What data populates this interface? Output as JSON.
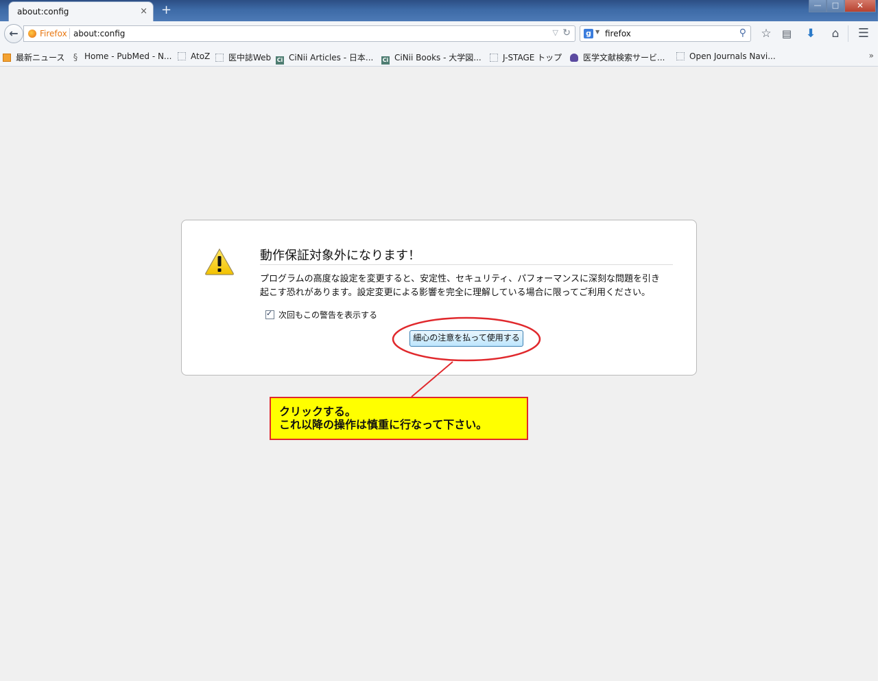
{
  "window": {
    "tab_title": "about:config",
    "tab_close": "×",
    "new_tab": "+",
    "minimize": "—",
    "restore": "□",
    "close": "✕"
  },
  "navbar": {
    "identity_label": "Firefox",
    "url": "about:config",
    "search_engine_icon": "g",
    "search_value": "firefox",
    "icons": [
      "back-arrow-icon",
      "bookmark-star-icon",
      "reading-list-icon",
      "download-icon",
      "home-icon",
      "menu-icon"
    ]
  },
  "bookmarks": {
    "items": [
      {
        "label": "最新ニュース"
      },
      {
        "label": "Home - PubMed - N..."
      },
      {
        "label": "AtoZ"
      },
      {
        "label": "医中誌Web"
      },
      {
        "label": "CiNii Articles - 日本..."
      },
      {
        "label": "CiNii Books - 大学図..."
      },
      {
        "label": "J-STAGE トップ"
      },
      {
        "label": "医学文献検索サービ..."
      },
      {
        "label": "Open Journals Navi..."
      }
    ],
    "more": "»"
  },
  "warning": {
    "title": "動作保証対象外になります！",
    "body_line1": "プログラムの高度な設定を変更すると、安定性、セキュリティ、パフォーマンスに深刻な問題を引き",
    "body_line2": "起こす恐れがあります。設定変更による影響を完全に理解している場合に限ってご利用ください。",
    "checkbox_label": "次回もこの警告を表示する",
    "checkbox_checked": true,
    "accept_button": "細心の注意を払って使用する"
  },
  "annotation": {
    "line1": "クリックする。",
    "line2": "これ以降の操作は慎重に行なって下さい。",
    "ellipse_color": "#e0282c",
    "callout_bg": "#ffff00"
  }
}
